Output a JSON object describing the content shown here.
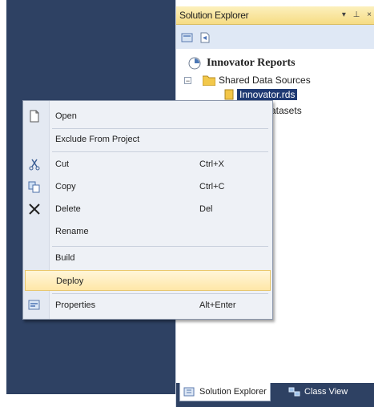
{
  "solution_explorer": {
    "title": "Solution Explorer",
    "title_controls": [
      "▾",
      "⊥",
      "×"
    ],
    "root_label": "Innovator Reports",
    "tree": {
      "shared_data_sources": {
        "label": "Shared Data Sources",
        "expander": "−"
      },
      "selected_file": {
        "label": "Innovator.rds"
      },
      "datasets": {
        "label": "atasets"
      }
    }
  },
  "context_menu": {
    "items": [
      {
        "label": "Open",
        "shortcut": "",
        "icon": "open-icon"
      },
      {
        "label": "Exclude From Project",
        "shortcut": "",
        "icon": ""
      },
      {
        "label": "Cut",
        "shortcut": "Ctrl+X",
        "icon": "cut-icon"
      },
      {
        "label": "Copy",
        "shortcut": "Ctrl+C",
        "icon": "copy-icon"
      },
      {
        "label": "Delete",
        "shortcut": "Del",
        "icon": "delete-icon"
      },
      {
        "label": "Rename",
        "shortcut": "",
        "icon": ""
      },
      {
        "label": "Build",
        "shortcut": "",
        "icon": ""
      },
      {
        "label": "Deploy",
        "shortcut": "",
        "icon": "",
        "highlighted": true
      },
      {
        "label": "Properties",
        "shortcut": "Alt+Enter",
        "icon": "properties-icon"
      }
    ]
  },
  "bottom_tabs": {
    "solution_explorer": "Solution Explorer",
    "class_view": "Class View"
  },
  "colors": {
    "workspace": "#2e4163",
    "title_gradient_top": "#fcf0bd",
    "title_gradient_bottom": "#f6dc84",
    "selection": "#1f3a73",
    "menu_highlight": "#ffe7a8"
  }
}
